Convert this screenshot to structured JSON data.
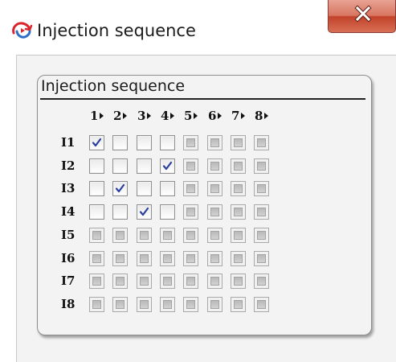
{
  "window": {
    "title": "Injection sequence",
    "app_icon": "sequence-app-icon",
    "close_icon": "close-x-icon"
  },
  "group": {
    "title": "Injection sequence"
  },
  "columns": [
    "1",
    "2",
    "3",
    "4",
    "5",
    "6",
    "7",
    "8"
  ],
  "rows": [
    "I1",
    "I2",
    "I3",
    "I4",
    "I5",
    "I6",
    "I7",
    "I8"
  ],
  "matrix": [
    [
      "checked",
      "unchecked",
      "unchecked",
      "unchecked",
      "disabled",
      "disabled",
      "disabled",
      "disabled"
    ],
    [
      "unchecked",
      "unchecked",
      "unchecked",
      "checked",
      "disabled",
      "disabled",
      "disabled",
      "disabled"
    ],
    [
      "unchecked",
      "checked",
      "unchecked",
      "unchecked",
      "disabled",
      "disabled",
      "disabled",
      "disabled"
    ],
    [
      "unchecked",
      "unchecked",
      "checked",
      "unchecked",
      "disabled",
      "disabled",
      "disabled",
      "disabled"
    ],
    [
      "disabled",
      "disabled",
      "disabled",
      "disabled",
      "disabled",
      "disabled",
      "disabled",
      "disabled"
    ],
    [
      "disabled",
      "disabled",
      "disabled",
      "disabled",
      "disabled",
      "disabled",
      "disabled",
      "disabled"
    ],
    [
      "disabled",
      "disabled",
      "disabled",
      "disabled",
      "disabled",
      "disabled",
      "disabled",
      "disabled"
    ],
    [
      "disabled",
      "disabled",
      "disabled",
      "disabled",
      "disabled",
      "disabled",
      "disabled",
      "disabled"
    ]
  ],
  "colors": {
    "check_mark": "#2b3f9e",
    "close_button": "#c7492f",
    "app_icon_red": "#d8262f",
    "app_icon_blue": "#2c6fc4"
  }
}
